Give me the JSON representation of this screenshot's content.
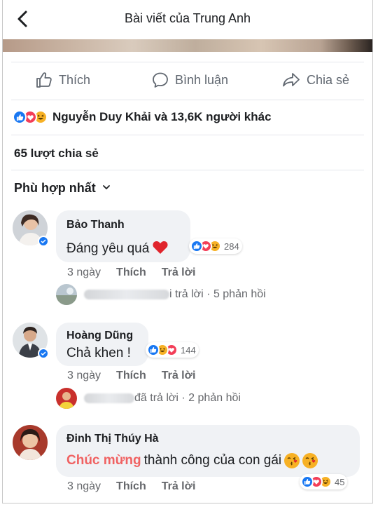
{
  "header": {
    "title": "Bài viết của Trung Anh"
  },
  "actions": {
    "like": "Thích",
    "comment": "Bình luận",
    "share": "Chia sẻ"
  },
  "reactions_summary": {
    "text": "Nguyễn Duy Khải và 13,6K người khác"
  },
  "shares": {
    "text": "65 lượt chia sẻ"
  },
  "sort": {
    "label": "Phù hợp nhất"
  },
  "comments": [
    {
      "author": "Bảo Thanh",
      "text": "Đáng yêu quá",
      "reaction_count": "284",
      "time": "3 ngày",
      "like_label": "Thích",
      "reply_label": "Trả lời",
      "replies_text": "i trả lời · 5 phản hồi"
    },
    {
      "author": "Hoàng Dũng",
      "text": "Chả khen !",
      "reaction_count": "144",
      "time": "3 ngày",
      "like_label": "Thích",
      "reply_label": "Trả lời",
      "replies_text": "đã trả lời · 2 phản hồi"
    },
    {
      "author": "Đinh Thị Thúy Hà",
      "text_accent": "Chúc mừng",
      "text_rest": "thành công của con gái",
      "reaction_count": "45",
      "time": "3 ngày",
      "like_label": "Thích",
      "reply_label": "Trả lời"
    }
  ],
  "colors": {
    "brand_blue": "#1877f2",
    "love_red": "#f33e58",
    "haha_yellow": "#f7b125",
    "accent_red": "#f06262",
    "muted": "#65676b"
  },
  "icons": [
    "back-arrow-icon",
    "thumbs-up-icon",
    "comment-bubble-icon",
    "share-arrow-icon",
    "chevron-down-icon",
    "like-reaction-icon",
    "love-reaction-icon",
    "haha-reaction-icon",
    "verified-badge-icon",
    "red-heart-emoji",
    "kiss-emoji"
  ]
}
